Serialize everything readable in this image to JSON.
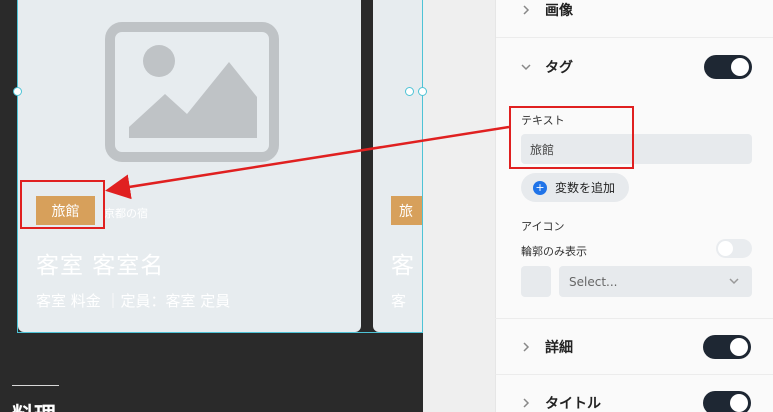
{
  "canvas": {
    "card1": {
      "tag": "旅館",
      "note": "京都の宿",
      "title": "客室 客室名",
      "subtitle": "客室 料金 ｜定員：客室 定員"
    },
    "card2": {
      "tag": "旅",
      "title": "客",
      "subtitle": "客"
    },
    "section_label": "料理"
  },
  "panel": {
    "rows": [
      {
        "label": "画像",
        "icon": "chevron-right-icon",
        "toggle": null
      },
      {
        "label": "タグ",
        "icon": "chevron-down-icon",
        "toggle": "on"
      },
      {
        "label": "詳細",
        "icon": "chevron-right-icon",
        "toggle": "on"
      },
      {
        "label": "タイトル",
        "icon": "chevron-right-icon",
        "toggle": "on"
      }
    ],
    "text_label": "テキスト",
    "text_value": "旅館",
    "add_variable": "変数を追加",
    "icon_label": "アイコン",
    "outline_only": "輪郭のみ表示",
    "outline_toggle": "off",
    "select_placeholder": "Select..."
  },
  "colors": {
    "accent": "#1e2733",
    "tag": "#d7a05b",
    "highlight": "#e02020",
    "selection": "#4ec3d6",
    "link": "#1f73e8"
  }
}
